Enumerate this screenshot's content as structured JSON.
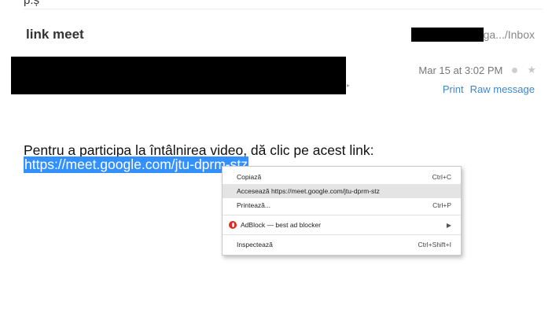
{
  "header": {
    "top_fragment": "p.ș",
    "subject": "link meet",
    "folder_path": "ga.../Inbox"
  },
  "message": {
    "date": "Mar 15 at 3:02 PM",
    "actions": {
      "print": "Print",
      "raw": "Raw message"
    },
    "body_text": "Pentru a participa la întâlnirea video, dă clic pe acest link:",
    "link": "https://meet.google.com/jtu-dprm-stz"
  },
  "context_menu": {
    "items": [
      {
        "label": "Copiază",
        "shortcut": "Ctrl+C"
      },
      {
        "label": "Accesează https://meet.google.com/jtu-dprm-stz",
        "shortcut": ""
      },
      {
        "label": "Printează...",
        "shortcut": "Ctrl+P"
      },
      {
        "label": "AdBlock — best ad blocker",
        "shortcut": "",
        "icon": "opera-icon",
        "submenu": true
      },
      {
        "label": "Inspectează",
        "shortcut": "Ctrl+Shift+I"
      }
    ]
  },
  "colors": {
    "selection": "#3390ff",
    "link_action": "#3f86c9",
    "menu_hover": "#e4e4e4"
  }
}
